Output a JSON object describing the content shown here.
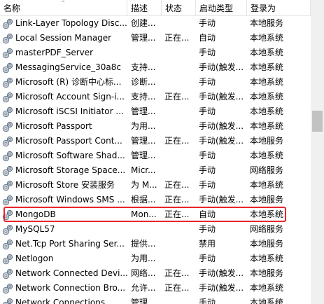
{
  "columns": {
    "name": "名称",
    "desc": "描述",
    "status": "状态",
    "startup": "启动类型",
    "logon": "登录为"
  },
  "rows": [
    {
      "name": "Link-Layer Topology Disc...",
      "desc": "创建...",
      "status": "",
      "startup": "手动",
      "logon": "本地服务"
    },
    {
      "name": "Local Session Manager",
      "desc": "管理...",
      "status": "正在...",
      "startup": "自动",
      "logon": "本地系统"
    },
    {
      "name": "masterPDF_Server",
      "desc": "",
      "status": "",
      "startup": "手动",
      "logon": "本地系统"
    },
    {
      "name": "MessagingService_30a8c",
      "desc": "支持...",
      "status": "",
      "startup": "手动(触发...",
      "logon": "本地系统"
    },
    {
      "name": "Microsoft (R) 诊断中心标...",
      "desc": "诊断...",
      "status": "",
      "startup": "手动",
      "logon": "本地系统"
    },
    {
      "name": "Microsoft Account Sign-i...",
      "desc": "支持...",
      "status": "正在...",
      "startup": "手动(触发...",
      "logon": "本地系统"
    },
    {
      "name": "Microsoft iSCSI Initiator ...",
      "desc": "管理...",
      "status": "",
      "startup": "手动",
      "logon": "本地系统"
    },
    {
      "name": "Microsoft Passport",
      "desc": "为用...",
      "status": "",
      "startup": "手动(触发...",
      "logon": "本地系统"
    },
    {
      "name": "Microsoft Passport Cont...",
      "desc": "管理...",
      "status": "正在...",
      "startup": "手动(触发...",
      "logon": "本地服务"
    },
    {
      "name": "Microsoft Software Shad...",
      "desc": "管理...",
      "status": "",
      "startup": "手动",
      "logon": "本地系统"
    },
    {
      "name": "Microsoft Storage Space...",
      "desc": "Micr...",
      "status": "",
      "startup": "手动",
      "logon": "网络服务"
    },
    {
      "name": "Microsoft Store 安装服务",
      "desc": "为 M...",
      "status": "正在...",
      "startup": "手动",
      "logon": "本地系统"
    },
    {
      "name": "Microsoft Windows SMS ...",
      "desc": "根据...",
      "status": "正在...",
      "startup": "手动(触发...",
      "logon": "本地服务"
    },
    {
      "name": "MongoDB",
      "desc": "Mon...",
      "status": "正在...",
      "startup": "自动",
      "logon": "本地系统"
    },
    {
      "name": "MySQL57",
      "desc": "",
      "status": "",
      "startup": "手动",
      "logon": "网络服务"
    },
    {
      "name": "Net.Tcp Port Sharing Ser...",
      "desc": "提供...",
      "status": "",
      "startup": "禁用",
      "logon": "本地服务"
    },
    {
      "name": "Netlogon",
      "desc": "为用...",
      "status": "",
      "startup": "手动",
      "logon": "本地系统"
    },
    {
      "name": "Network Connected Devi...",
      "desc": "网络...",
      "status": "正在...",
      "startup": "手动(触发...",
      "logon": "本地服务"
    },
    {
      "name": "Network Connection Bro...",
      "desc": "允许...",
      "status": "正在...",
      "startup": "手动(触发...",
      "logon": "本地系统"
    },
    {
      "name": "Network Connections",
      "desc": "管理...",
      "status": "",
      "startup": "手动",
      "logon": "本地系统"
    }
  ],
  "highlight_color": "#e8262b",
  "icon": "gear-icon"
}
